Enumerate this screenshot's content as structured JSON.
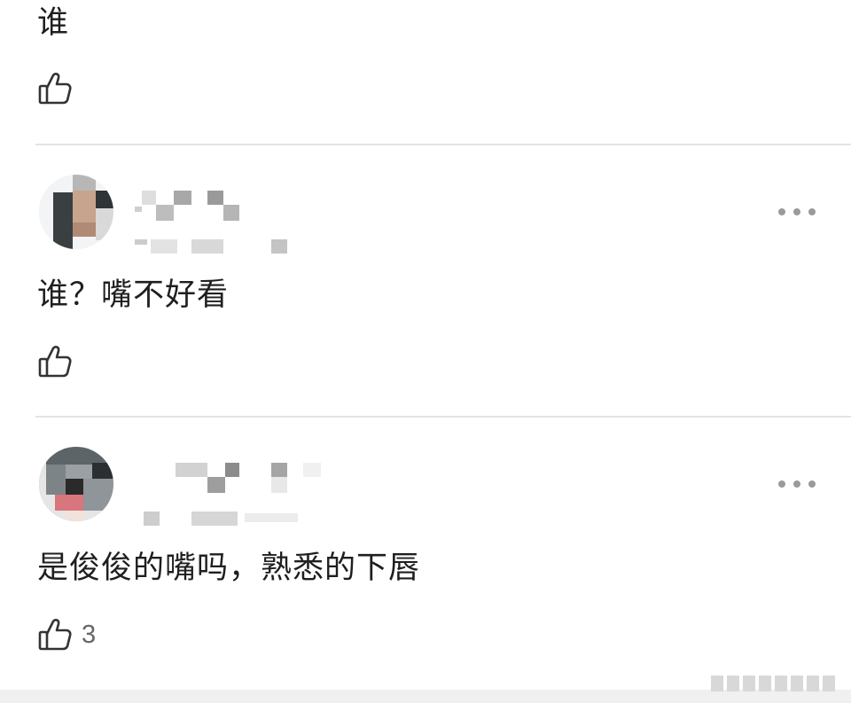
{
  "comments": [
    {
      "text": "谁",
      "like_count": ""
    },
    {
      "text": "谁？嘴不好看",
      "like_count": ""
    },
    {
      "text": "是俊俊的嘴吗，熟悉的下唇",
      "like_count": "3"
    }
  ],
  "icons": {
    "like": "thumbs-up-icon",
    "more": "more-horizontal-icon"
  },
  "colors": {
    "text": "#1f1f1f",
    "like_count": "#666666",
    "divider": "#e4e4e4",
    "more_dots": "#9a9a9a"
  }
}
